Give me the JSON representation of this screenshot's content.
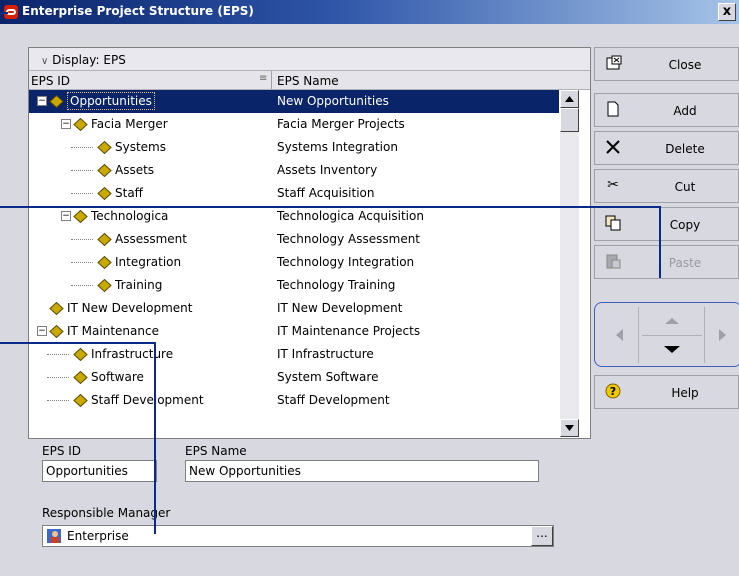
{
  "window": {
    "title": "Enterprise Project Structure (EPS)",
    "close_glyph": "x"
  },
  "display": {
    "label": "Display: EPS"
  },
  "grid": {
    "headers": {
      "eps_id": "EPS ID",
      "eps_name": "EPS Name"
    },
    "rows": [
      {
        "id": "Opportunities",
        "name": "New Opportunities",
        "depth": 0,
        "expander": "−",
        "selected": true
      },
      {
        "id": "Facia Merger",
        "name": "Facia Merger Projects",
        "depth": 1,
        "expander": "−"
      },
      {
        "id": "Systems",
        "name": "Systems Integration",
        "depth": 2
      },
      {
        "id": "Assets",
        "name": "Assets Inventory",
        "depth": 2
      },
      {
        "id": "Staff",
        "name": "Staff Acquisition",
        "depth": 2
      },
      {
        "id": "Technologica",
        "name": "Technologica Acquisition",
        "depth": 1,
        "expander": "−"
      },
      {
        "id": "Assessment",
        "name": "Technology Assessment",
        "depth": 2
      },
      {
        "id": "Integration",
        "name": "Technology Integration",
        "depth": 2
      },
      {
        "id": "Training",
        "name": "Technology Training",
        "depth": 2
      },
      {
        "id": "IT New Development",
        "name": "IT New Development",
        "depth": 0
      },
      {
        "id": "IT Maintenance",
        "name": "IT Maintenance Projects",
        "depth": 0,
        "expander": "−"
      },
      {
        "id": "Infrastructure",
        "name": "IT Infrastructure",
        "depth": 1
      },
      {
        "id": "Software",
        "name": "System Software",
        "depth": 1
      },
      {
        "id": "Staff Development",
        "name": "Staff Development",
        "depth": 1
      }
    ]
  },
  "details": {
    "eps_id_label": "EPS ID",
    "eps_id_value": "Opportunities",
    "eps_name_label": "EPS Name",
    "eps_name_value": "New Opportunities",
    "manager_label": "Responsible Manager",
    "manager_value": "Enterprise",
    "ellipsis": "..."
  },
  "buttons": {
    "close": "Close",
    "add": "Add",
    "delete": "Delete",
    "cut": "Cut",
    "copy": "Copy",
    "paste": "Paste",
    "help": "Help"
  },
  "icons": {
    "close": "close-window-icon",
    "add": "new-document-icon",
    "delete": "x-icon",
    "cut": "scissors-icon",
    "copy": "copy-icon",
    "paste": "paste-icon",
    "help": "question-icon",
    "node": "eps-node-icon",
    "manager": "user-icon"
  },
  "colors": {
    "title_bar": "#0a246a",
    "selection": "#0a246a",
    "callout": "#0a2a8a",
    "node_icon": "#c9a800",
    "help_icon": "#f0c800"
  }
}
